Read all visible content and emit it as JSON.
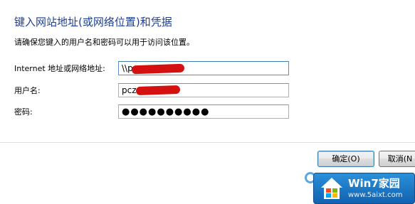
{
  "dialog": {
    "heading": "键入网站地址(或网络位置)和凭据",
    "instruction": "请确保您键入的用户名和密码可以用于访问该位置。"
  },
  "form": {
    "address_label": "Internet 地址或网络地址:",
    "address_value": "\\\\pc",
    "username_label": "用户名:",
    "username_value": "pcz",
    "password_label": "密码:",
    "password_value": "●●●●●●●●●●"
  },
  "buttons": {
    "ok_label": "确定(O)",
    "cancel_label": "取消(N"
  },
  "watermark": {
    "title": "Win7家园",
    "url": "www.5aixt.com"
  },
  "colors": {
    "heading": "#1f3f8f",
    "redaction": "#d41010",
    "watermark": "#1a74c4"
  }
}
